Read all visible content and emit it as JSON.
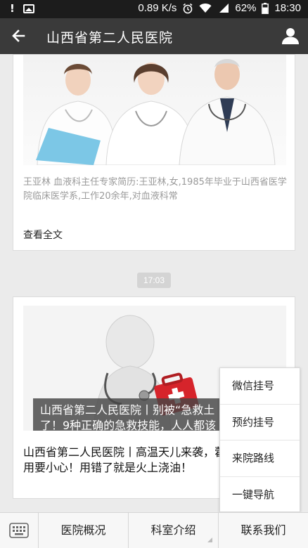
{
  "status_bar": {
    "speed": "0.89 K/s",
    "battery": "62%",
    "time": "18:30"
  },
  "header": {
    "title": "山西省第二人民医院"
  },
  "article1": {
    "excerpt": "王亚林  血液科主任专家简历:王亚林,女,1985年毕业于山西省医学院临床医学系,工作20余年,对血液科常",
    "read_more": "查看全文"
  },
  "timestamp": "17:03",
  "article2": {
    "banner_caption_line1": "山西省第二人民医院丨别被“急救土",
    "banner_caption_line2": "了！9种正确的急救技能，人人都该",
    "title": "山西省第二人民医院丨高温天儿来袭，藿香正气水服用要小心！用错了就是火上浇油！"
  },
  "popup_menu": {
    "items": [
      "微信挂号",
      "预约挂号",
      "来院路线",
      "一键导航"
    ]
  },
  "bottom_menu": {
    "tabs": [
      "医院概况",
      "科室介绍",
      "联系我们"
    ]
  },
  "colors": {
    "status_bar_bg": "#1c1c1c",
    "title_bar_bg": "#3a3a3a",
    "page_bg": "#ebebeb"
  }
}
